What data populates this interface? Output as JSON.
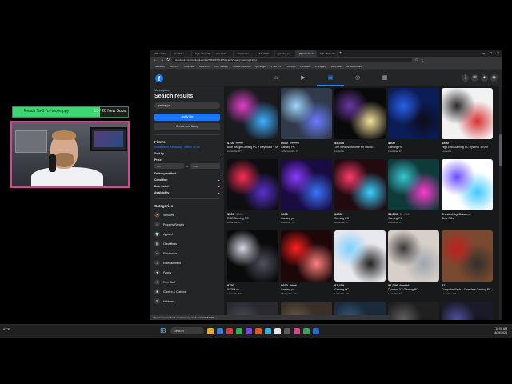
{
  "goal": {
    "text": "Peach Ta-8 I'm tricomppy",
    "count": "15 / 20 New Subs"
  },
  "browser": {
    "tabs": [
      "EDR on the",
      "YouTube",
      "CyberPowerP",
      "Inbox (27)",
      "Amazon.co",
      "SKU 3035",
      "gaming pc",
      "(8) Facebook",
      "CyberPowerP"
    ],
    "url": "facebook.com/marketplace/112768468771675/search/?query=gaming%20pc",
    "bookmarks": [
      "Tradeview",
      "YouTube",
      "StreetBee",
      "Algarithm",
      "IPAD Weekly",
      "Google Calendar",
      "gamingpc",
      "PTEn 3.2",
      "Finances",
      "Hardware",
      "PWSpace",
      "Hardware",
      "All Bookmarks"
    ],
    "status_url": "https://www.facebook.com/marketplace/item/1234567890/"
  },
  "sidebar": {
    "crumb": "Marketplace",
    "title": "Search results",
    "search_value": "gaming pc",
    "notify": "Notify Me",
    "create": "Create new listing",
    "filters_head": "Filters",
    "location": "Middletown, Kentucky · Within 40 mi",
    "sort_by": "Sort by",
    "price": "Price",
    "min": "Min",
    "to": "to",
    "max": "Max",
    "delivery": "Delivery method",
    "condition": "Condition",
    "date_listed": "Date listed",
    "availability": "Availability",
    "categories_head": "Categories",
    "categories": [
      "Vehicles",
      "Property Rentals",
      "Apparel",
      "Classifieds",
      "Electronics",
      "Entertainment",
      "Family",
      "Free Stuff",
      "Garden & Outdoor",
      "Hobbies"
    ]
  },
  "listings": [
    {
      "price": "$700",
      "old": "$850",
      "title": "Blue Beage Gaming PC + Keyboard + Mouse",
      "loc": "Louisville, KY",
      "colors": [
        "#1a1a1f",
        "#e040c8",
        "#3fb0ff"
      ]
    },
    {
      "price": "$650",
      "old": "$1,000",
      "title": "Gaming PC",
      "loc": "Jeffersonville, IN",
      "colors": [
        "#303a4a",
        "#9fd7ff",
        "#6a7bff"
      ]
    },
    {
      "price": "$4,500",
      "old": "",
      "title": "The New Workhorse for Studio...",
      "loc": "Louisville",
      "colors": [
        "#090909",
        "#6b3aa5",
        "#f5e3a0"
      ]
    },
    {
      "price": "$500",
      "old": "",
      "title": "Gaming Pc",
      "loc": "Louisville, KY",
      "colors": [
        "#0b1d57",
        "#2960e8",
        "#0d0d18"
      ]
    },
    {
      "price": "$450",
      "old": "",
      "title": "High-End Gaming PC Ryzen 7 5700x",
      "loc": "Louisville",
      "colors": [
        "#f2f2f2",
        "#2a2a2a",
        "#d93030"
      ]
    },
    {
      "price": "$500",
      "old": "$550",
      "title": "RGB Gaming PC",
      "loc": "Louisville, KY",
      "colors": [
        "#0d0d12",
        "#ff2d55",
        "#5a30d0"
      ]
    },
    {
      "price": "$400",
      "old": "",
      "title": "Gaming pc",
      "loc": "Louisville, KY",
      "colors": [
        "#1a0b40",
        "#8a3cff",
        "#3a74ff"
      ]
    },
    {
      "price": "$450",
      "old": "",
      "title": "Gaming PC",
      "loc": "Louisville, KY",
      "colors": [
        "#220a10",
        "#ff3c6a",
        "#3ad0ff"
      ]
    },
    {
      "price": "$1,000",
      "old": "$1,050",
      "title": "Gaming PC",
      "loc": "Louisville, KY",
      "colors": [
        "#0f3a3a",
        "#39c6d0",
        "#ff3ad0"
      ]
    },
    {
      "price": "Trusted by Gamers",
      "old": "",
      "title": "Skitz PCs",
      "loc": "",
      "colors": [
        "#ffffff",
        "#6a4cff",
        "#40c8ff"
      ]
    },
    {
      "price": "$750",
      "old": "",
      "title": "5078 it sc",
      "loc": "Louisville, KY",
      "colors": [
        "#0a0a0a",
        "#d8d8e8",
        "#505060"
      ]
    },
    {
      "price": "$600",
      "old": "$650",
      "title": "Gaming pc",
      "loc": "Shelbyville, KY",
      "colors": [
        "#1d0707",
        "#ff2020",
        "#ff8080"
      ]
    },
    {
      "price": "$1,450",
      "old": "",
      "title": "Gaming PC",
      "loc": "Louisville, KY",
      "colors": [
        "#e8e8ee",
        "#7fd0ff",
        "#222"
      ]
    },
    {
      "price": "$1,000",
      "old": "$1,450",
      "title": "Dymond XX Gaming PC",
      "loc": "Louisville, KY",
      "colors": [
        "#d8d0c8",
        "#3a3a3a",
        "#9fa5b0"
      ]
    },
    {
      "price": "$11",
      "old": "",
      "title": "Computer Parts - Complete Gaming PC, CPUs, PSU, RAM, Hard drive...",
      "loc": "Louisville, KY",
      "colors": [
        "#7a4a30",
        "#c02020",
        "#30302a"
      ]
    },
    {
      "price": "",
      "old": "",
      "title": "",
      "loc": "",
      "colors": [
        "#2a2a30",
        "#4a4a55",
        "#1a1a20"
      ]
    },
    {
      "price": "",
      "old": "",
      "title": "",
      "loc": "",
      "colors": [
        "#3a3028",
        "#6a5a48",
        "#1a1814"
      ]
    },
    {
      "price": "",
      "old": "",
      "title": "",
      "loc": "",
      "colors": [
        "#1a2a3a",
        "#3a5a7a",
        "#0a1420"
      ]
    },
    {
      "price": "",
      "old": "",
      "title": "",
      "loc": "",
      "colors": [
        "#202020",
        "#606060",
        "#101010"
      ]
    },
    {
      "price": "",
      "old": "",
      "title": "",
      "loc": "",
      "colors": [
        "#1a1a28",
        "#5050a0",
        "#0a0a14"
      ]
    }
  ],
  "taskbar": {
    "weather": "81°F",
    "search": "Search",
    "time": "10:00 AM",
    "date": "8/29/2024",
    "icon_colors": [
      "#e8b02a",
      "#3a7bd5",
      "#d83a3a",
      "#2ab050",
      "#7a4ae0",
      "#e05a20",
      "#3ab0e0",
      "#e8e8e8",
      "#5a5a5a",
      "#d04a90",
      "#40a060",
      "#2a6ad0"
    ]
  }
}
